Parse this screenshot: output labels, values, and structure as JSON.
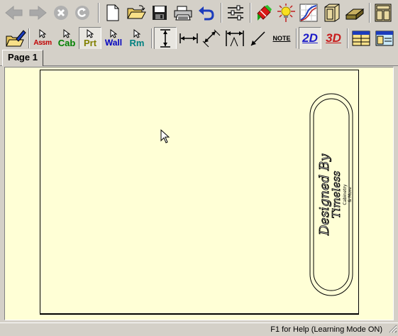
{
  "toolbar1": {
    "buttons": [
      "back-icon",
      "forward-icon",
      "stop-icon",
      "refresh-icon",
      "new-document-icon",
      "open-folder-icon",
      "save-icon",
      "print-icon",
      "undo-icon",
      "settings-sliders-icon",
      "paint-icon",
      "light-bulb-icon",
      "chart-icon",
      "cabinet-outline-icon",
      "panel-material-icon",
      "cabinet-icon"
    ]
  },
  "toolbar2": {
    "mode_buttons": [
      {
        "label": "Assm",
        "color": "#c00000"
      },
      {
        "label": "Cab",
        "color": "#008000"
      },
      {
        "label": "Prt",
        "color": "#808000"
      },
      {
        "label": "Wall",
        "color": "#0000c0"
      },
      {
        "label": "Rm",
        "color": "#008080"
      }
    ],
    "note_label": "NOTE",
    "view_2d_label": "2D",
    "view_3d_label": "3D"
  },
  "tabs": [
    {
      "label": "Page 1",
      "active": true
    }
  ],
  "title_block": {
    "line1": "Designed By",
    "line2": "Timeless",
    "line3": "Cabinetry",
    "line4": "& More"
  },
  "status": {
    "help_text": "F1 for Help (Learning Mode ON)"
  },
  "colors": {
    "canvas_bg": "#ffffd6",
    "chrome": "#d4d0c8"
  }
}
